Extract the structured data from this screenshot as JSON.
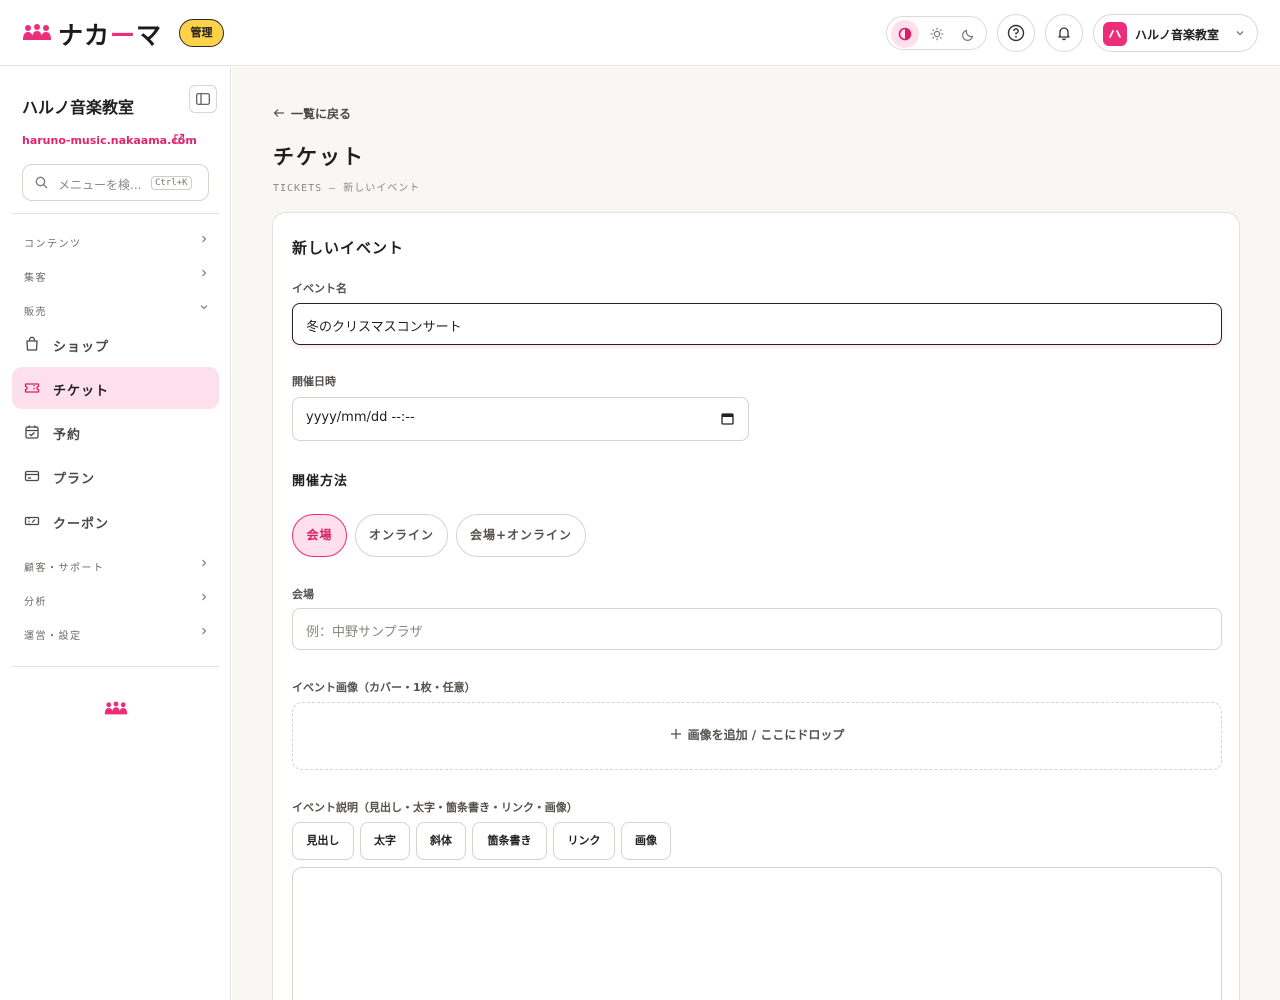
{
  "brand": {
    "name_prefix": "ナカ",
    "name_dash": "ー",
    "name_suffix": "マ",
    "admin_badge": "管理",
    "accent_color": "#ec2d7a"
  },
  "header": {
    "theme_options": [
      "contrast-icon",
      "sun-icon",
      "moon-icon"
    ],
    "active_theme": "contrast-icon",
    "account_name": "ハルノ音楽教室"
  },
  "sidebar": {
    "site_name": "ハルノ音楽教室",
    "site_url": "haruno-music.nakaama.com",
    "search_placeholder": "メニューを検...",
    "search_shortcut": "Ctrl+K",
    "groups": {
      "content": "コンテンツ",
      "marketing": "集客",
      "sales": "販売",
      "customers": "顧客・サポート",
      "analytics": "分析",
      "operations": "運営・設定"
    },
    "items": [
      {
        "label": "ショップ",
        "icon": "shopping-bag-icon"
      },
      {
        "label": "チケット",
        "icon": "ticket-icon",
        "active": true
      },
      {
        "label": "予約",
        "icon": "calendar-check-icon"
      },
      {
        "label": "プラン",
        "icon": "credit-card-icon"
      },
      {
        "label": "クーポン",
        "icon": "coupon-icon"
      }
    ]
  },
  "main": {
    "back_label": "一覧に戻る",
    "page_title": "チケット",
    "breadcrumb": "TICKETS — 新しいイベント",
    "form": {
      "card_title": "新しいイベント",
      "event_name_label": "イベント名",
      "event_name_value": "冬のクリスマスコンサート",
      "datetime_label": "開催日時",
      "datetime_value": "yyyy/mm/dd --:--",
      "method_title": "開催方法",
      "method_options": [
        "会場",
        "オンライン",
        "会場+オンライン"
      ],
      "method_selected": "会場",
      "venue_label": "会場",
      "venue_placeholder": "例：中野サンプラザ",
      "image_label": "イベント画像（カバー・1枚・任意）",
      "image_drop": "画像を追加 / ここにドロップ",
      "desc_label": "イベント説明（見出し・太字・箇条書き・リンク・画像）",
      "toolbar": [
        "見出し",
        "太字",
        "斜体",
        "箇条書き",
        "リンク",
        "画像"
      ]
    }
  }
}
